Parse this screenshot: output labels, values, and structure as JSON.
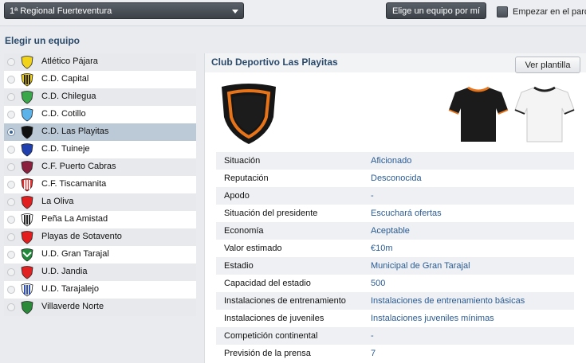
{
  "topbar": {
    "division": "1ª Regional Fuerteventura",
    "pick_button": "Elige un equipo por mí",
    "start_label": "Empezar en el parc"
  },
  "team_panel": {
    "title": "Elegir un equipo",
    "teams": [
      {
        "name": "Atlético Pájara",
        "selected": false
      },
      {
        "name": "C.D. Capital",
        "selected": false
      },
      {
        "name": "C.D. Chilegua",
        "selected": false
      },
      {
        "name": "C.D. Cotillo",
        "selected": false
      },
      {
        "name": "C.D. Las Playitas",
        "selected": true
      },
      {
        "name": "C.D. Tuineje",
        "selected": false
      },
      {
        "name": "C.F. Puerto Cabras",
        "selected": false
      },
      {
        "name": "C.F. Tiscamanita",
        "selected": false
      },
      {
        "name": "La Oliva",
        "selected": false
      },
      {
        "name": "Peña La Amistad",
        "selected": false
      },
      {
        "name": "Playas de Sotavento",
        "selected": false
      },
      {
        "name": "U.D. Gran Tarajal",
        "selected": false
      },
      {
        "name": "U.D. Jandia",
        "selected": false
      },
      {
        "name": "U.D. Tarajalejo",
        "selected": false
      },
      {
        "name": "Villaverde Norte",
        "selected": false
      }
    ]
  },
  "club": {
    "name": "Club Deportivo Las Playitas",
    "squad_button": "Ver plantilla",
    "info": [
      {
        "label": "Situación",
        "value": "Aficionado"
      },
      {
        "label": "Reputación",
        "value": "Desconocida"
      },
      {
        "label": "Apodo",
        "value": "-"
      },
      {
        "label": "Situación del presidente",
        "value": "Escuchará ofertas"
      },
      {
        "label": "Economía",
        "value": "Aceptable"
      },
      {
        "label": "Valor estimado",
        "value": "€10m"
      },
      {
        "label": "Estadio",
        "value": "Municipal de Gran Tarajal"
      },
      {
        "label": "Capacidad del estadio",
        "value": "500"
      },
      {
        "label": "Instalaciones de entrenamiento",
        "value": "Instalaciones de entrenamiento básicas"
      },
      {
        "label": "Instalaciones de juveniles",
        "value": "Instalaciones juveniles mínimas"
      },
      {
        "label": "Competición continental",
        "value": "-"
      },
      {
        "label": "Previsión de la prensa",
        "value": "7"
      }
    ]
  },
  "colors": {
    "accent": "#2a4a6b",
    "value_link": "#2a5c96",
    "selected_row": "#bccad8",
    "crest_primary": "#1a1a1a",
    "crest_trim": "#e8741a"
  }
}
